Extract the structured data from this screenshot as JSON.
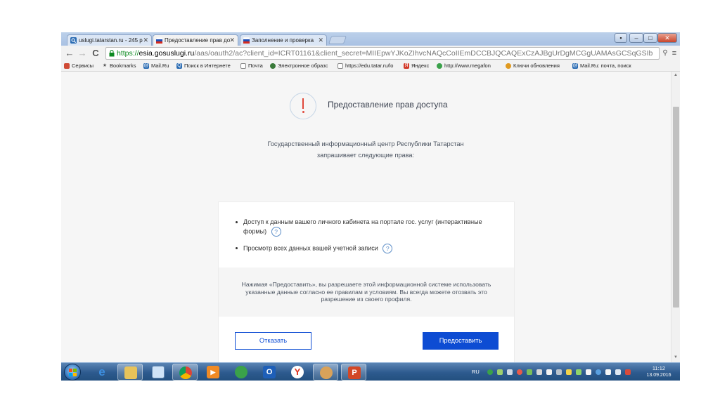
{
  "browser": {
    "tabs": [
      {
        "title": "uslugi.tatarstan.ru - 245 p",
        "favicon": "search-icon",
        "active": false
      },
      {
        "title": "Предоставление прав до",
        "favicon": "russia-flag-icon",
        "active": true
      },
      {
        "title": "Заполнение и проверка",
        "favicon": "russia-flag-icon",
        "active": false
      }
    ],
    "close_glyph": "✕",
    "url": {
      "scheme": "https://",
      "host": "esia.gosuslugi.ru",
      "path": "/aas/oauth2/ac?client_id=ICRT01161&client_secret=MIIEpwYJKoZIhvcNAQcCoIIEmDCCBJQCAQExCzAJBgUrDgMCGgUAMAsGCSqGSIb"
    },
    "nav": {
      "back": "←",
      "forward": "→",
      "reload": "C"
    },
    "bookmarks": [
      {
        "label": "Сервисы",
        "icon": "apps-icon",
        "color": "#d04b36"
      },
      {
        "label": "Bookmarks",
        "icon": "star-icon",
        "color": "#555555"
      },
      {
        "label": "Mail.Ru",
        "icon": "mailru-icon",
        "color": "#2b6cb3"
      },
      {
        "label": "Поиск в Интернете",
        "icon": "search-icon",
        "color": "#2b6cb3"
      },
      {
        "label": "Почта",
        "icon": "page-icon",
        "color": "#888888"
      },
      {
        "label": "Электронное образс",
        "icon": "globe-icon",
        "color": "#3a7a3a"
      },
      {
        "label": "https://edu.tatar.ru/lo",
        "icon": "page-icon",
        "color": "#888888"
      },
      {
        "label": "Яндекс",
        "icon": "yandex-icon",
        "color": "#d23a2a"
      },
      {
        "label": "http://www.megafon",
        "icon": "megafon-icon",
        "color": "#3aa14a"
      },
      {
        "label": "Ключи обновления",
        "icon": "key-icon",
        "color": "#e09a20"
      },
      {
        "label": "Mail.Ru: почта, поиск",
        "icon": "mailru-icon",
        "color": "#2b6cb3"
      }
    ]
  },
  "page": {
    "title": "Предоставление прав доступа",
    "requester_line1": "Государственный информационный центр Республики Татарстан",
    "requester_line2": "запрашивает следующие права:",
    "permissions": [
      {
        "text": "Доступ к данным вашего личного кабинета на портале гос. услуг (интерактивные формы)"
      },
      {
        "text": "Просмотр всех данных вашей учетной записи"
      }
    ],
    "help_glyph": "?",
    "notice": "Нажимая «Предоставить», вы разрешаете этой информационной системе использовать указанные данные согласно ее правилам и условиям. Вы всегда можете отозвать это разрешение из своего профиля.",
    "deny_label": "Отказать",
    "grant_label": "Предоставить"
  },
  "taskbar": {
    "language": "RU",
    "time": "11:12",
    "date": "13.09.2016",
    "apps": [
      "ie-icon",
      "explorer-icon",
      "notepad-icon",
      "chrome-icon",
      "media-player-icon",
      "network-icon",
      "outlook-icon",
      "yandex-browser-icon",
      "chrome-mail-icon",
      "powerpoint-icon"
    ]
  },
  "colors": {
    "primary_button": "#0d4cd3",
    "alert": "#e0473a",
    "url_scheme": "#0b8a1f"
  }
}
